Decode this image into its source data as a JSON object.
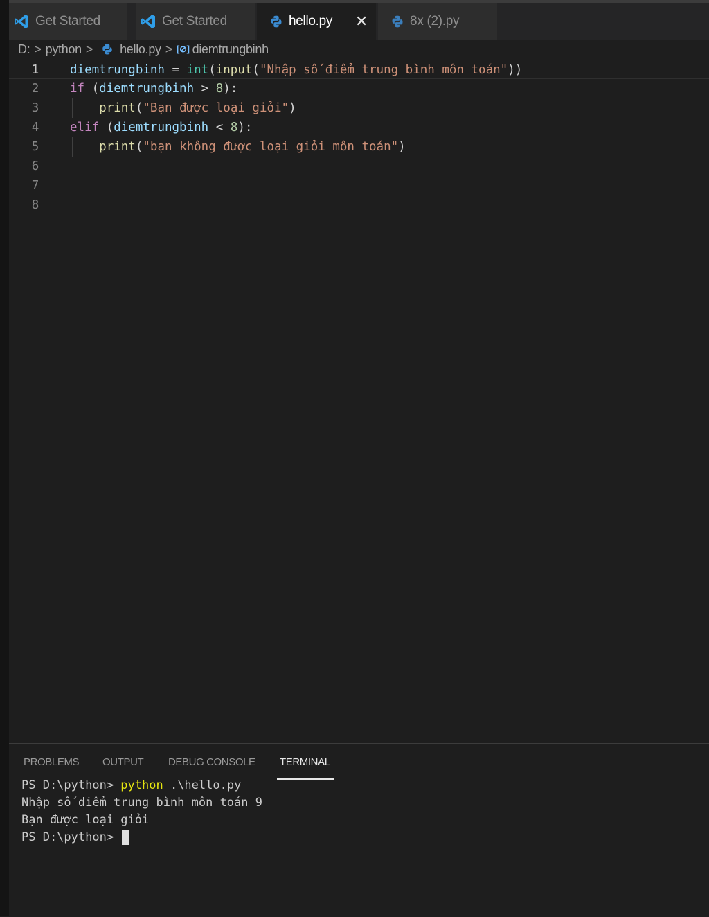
{
  "tabs": [
    {
      "label": "Get Started",
      "icon": "vscode-icon",
      "active": false
    },
    {
      "label": "Get Started",
      "icon": "vscode-icon",
      "active": false
    },
    {
      "label": "hello.py",
      "icon": "python-icon",
      "active": true,
      "close": "✕"
    },
    {
      "label": "8x (2).py",
      "icon": "python-icon",
      "active": false
    }
  ],
  "breadcrumb": {
    "drive": "D:",
    "folder": "python",
    "file": "hello.py",
    "symbol_icon": "[⊘]",
    "symbol": "diemtrungbinh",
    "separator": ">"
  },
  "editor": {
    "line_numbers": [
      "1",
      "2",
      "3",
      "4",
      "5",
      "6",
      "7",
      "8"
    ],
    "lines": [
      [
        {
          "t": "var",
          "v": "diemtrungbinh"
        },
        {
          "t": "op",
          "v": " = "
        },
        {
          "t": "cls",
          "v": "int"
        },
        {
          "t": "op",
          "v": "("
        },
        {
          "t": "fn",
          "v": "input"
        },
        {
          "t": "op",
          "v": "("
        },
        {
          "t": "str",
          "v": "\"Nhập số điểm trung bình môn toán\""
        },
        {
          "t": "op",
          "v": "))"
        }
      ],
      [
        {
          "t": "kw",
          "v": "if"
        },
        {
          "t": "op",
          "v": " ("
        },
        {
          "t": "var",
          "v": "diemtrungbinh"
        },
        {
          "t": "op",
          "v": " > "
        },
        {
          "t": "num",
          "v": "8"
        },
        {
          "t": "op",
          "v": "):"
        }
      ],
      [
        {
          "t": "op",
          "v": "    "
        },
        {
          "t": "fn",
          "v": "print"
        },
        {
          "t": "op",
          "v": "("
        },
        {
          "t": "str",
          "v": "\"Bạn được loại giỏi\""
        },
        {
          "t": "op",
          "v": ")"
        }
      ],
      [
        {
          "t": "kw",
          "v": "elif"
        },
        {
          "t": "op",
          "v": " ("
        },
        {
          "t": "var",
          "v": "diemtrungbinh"
        },
        {
          "t": "op",
          "v": " < "
        },
        {
          "t": "num",
          "v": "8"
        },
        {
          "t": "op",
          "v": "):"
        }
      ],
      [
        {
          "t": "op",
          "v": "    "
        },
        {
          "t": "fn",
          "v": "print"
        },
        {
          "t": "op",
          "v": "("
        },
        {
          "t": "str",
          "v": "\"bạn không được loại giỏi môn toán\""
        },
        {
          "t": "op",
          "v": ")"
        }
      ],
      [],
      [],
      []
    ]
  },
  "panel": {
    "tabs": [
      "PROBLEMS",
      "OUTPUT",
      "DEBUG CONSOLE",
      "TERMINAL"
    ],
    "active_tab": "TERMINAL",
    "terminal": {
      "prompt": "PS D:\\python> ",
      "command": "python",
      "command_args": " .\\hello.py",
      "output_1": "Nhập số điểm trung bình môn toán 9",
      "output_2": "Bạn được loại giỏi",
      "prompt_2": "PS D:\\python> "
    }
  },
  "colors": {
    "editor_bg": "#1e1e1e",
    "tabbar_bg": "#252526",
    "keyword": "#c586c0",
    "variable": "#9cdcfe",
    "string": "#ce9178",
    "function": "#dcdcaa",
    "class": "#4ec9b0",
    "number": "#b5cea8"
  }
}
